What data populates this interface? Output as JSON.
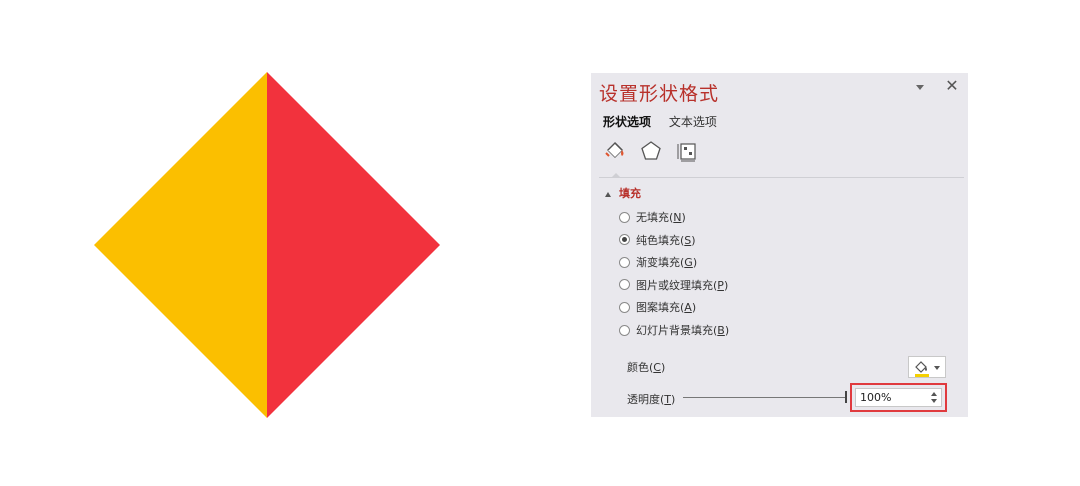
{
  "canvas": {
    "shape": {
      "left_color": "#fbbf00",
      "right_color": "#f2323d"
    }
  },
  "panel": {
    "title": "设置形状格式",
    "tabs": [
      {
        "label": "形状选项",
        "active": true
      },
      {
        "label": "文本选项",
        "active": false
      }
    ],
    "icons": [
      "fill-line-icon",
      "effects-pentagon-icon",
      "size-properties-icon"
    ],
    "section": {
      "title": "填充",
      "expanded": true
    },
    "fill_options": [
      {
        "text": "无填充(",
        "key": "N",
        "suffix": ")",
        "checked": false
      },
      {
        "text": "纯色填充(",
        "key": "S",
        "suffix": ")",
        "checked": true
      },
      {
        "text": "渐变填充(",
        "key": "G",
        "suffix": ")",
        "checked": false
      },
      {
        "text": "图片或纹理填充(",
        "key": "P",
        "suffix": ")",
        "checked": false
      },
      {
        "text": "图案填充(",
        "key": "A",
        "suffix": ")",
        "checked": false
      },
      {
        "text": "幻灯片背景填充(",
        "key": "B",
        "suffix": ")",
        "checked": false
      }
    ],
    "color": {
      "text": "颜色(",
      "key": "C",
      "suffix": ")",
      "swatch": "#f5d000"
    },
    "transparency": {
      "text": "透明度(",
      "key": "T",
      "suffix": ")",
      "value": "100%",
      "level": 1.0
    }
  }
}
